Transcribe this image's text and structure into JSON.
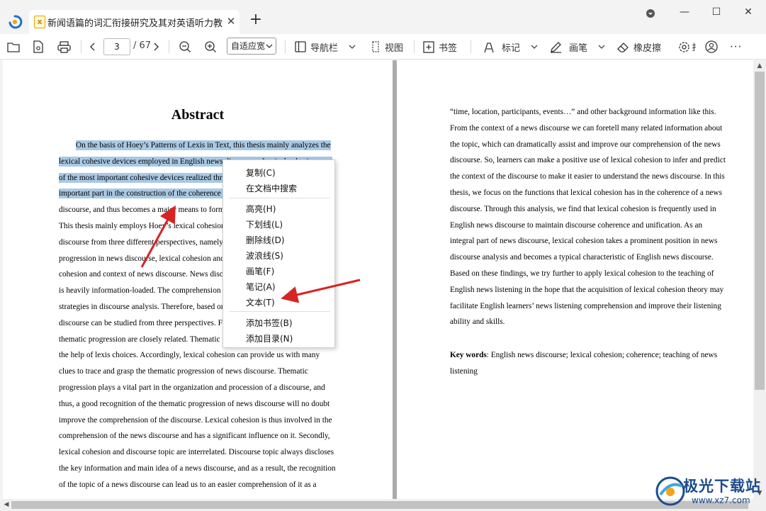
{
  "tab": {
    "title": "新闻语篇的词汇衔接研究及其对英语听力教...",
    "close": "✕"
  },
  "new_tab": "+",
  "window": {
    "menu": "▾",
    "minimize": "—",
    "maximize": "☐",
    "close": "✕"
  },
  "toolbar": {
    "page_current": "3",
    "page_total": "/ 67",
    "zoom": "自适应宽",
    "navbar": "导航栏",
    "view": "视图",
    "bookmark": "书签",
    "mark": "标记",
    "pen": "画笔",
    "eraser": "橡皮擦",
    "more": "···"
  },
  "doc": {
    "left": {
      "title": "Abstract",
      "lines": [
        {
          "t": "On the basis of Hoey’s Patterns of Lexis in Text, this thesis mainly analyzes the",
          "hl": true
        },
        {
          "t": "lexical cohesive devices employed in English news discourses. Lexical cohesion, one",
          "hl": true
        },
        {
          "t": "of the most important cohesive devices realized through vocabulary, is a prominent",
          "hl": true
        },
        {
          "t": "important part in the construction of the coherence and unification of news",
          "hl": true
        },
        {
          "t": "discourse, and thus becomes a major means to formulate a coherent news discourse.",
          "hl": false
        },
        {
          "t": "This thesis mainly employs Hoey’s lexical cohesion theory to analyze the news",
          "hl": false
        },
        {
          "t": "discourse from three different perspectives, namely, lexical cohesion and thematic",
          "hl": false
        },
        {
          "t": "progression in news discourse, lexical cohesion and discourse topic, and lexical",
          "hl": false
        },
        {
          "t": "cohesion and context of news discourse. News discourse is a specific genre which",
          "hl": false
        },
        {
          "t": "is heavily information-loaded. The comprehension of it requires different reading",
          "hl": false
        },
        {
          "t": "strategies in discourse analysis. Therefore, based on Hoey’s theory, the news",
          "hl": false
        },
        {
          "t": "discourse can be studied from three perspectives. Firstly, lexical cohesion and",
          "hl": false
        },
        {
          "t": "thematic progression are closely related. Thematic progression is realized with",
          "hl": false
        },
        {
          "t": "the help of lexis choices. Accordingly, lexical cohesion can provide us with many",
          "hl": false
        },
        {
          "t": "clues to trace and grasp the thematic progression of news discourse. Thematic",
          "hl": false
        },
        {
          "t": "progression plays a vital part in the organization and procession of a discourse, and",
          "hl": false
        },
        {
          "t": "thus, a good recognition of the thematic progression of news discourse will no doubt",
          "hl": false
        },
        {
          "t": "improve the comprehension of the discourse. Lexical cohesion is thus involved in the",
          "hl": false
        },
        {
          "t": "comprehension of the news discourse and has a significant influence on it. Secondly,",
          "hl": false
        },
        {
          "t": "lexical cohesion and discourse topic are interrelated. Discourse topic always discloses",
          "hl": false
        },
        {
          "t": "the key information and main idea of a news discourse, and as a result, the recognition",
          "hl": false
        },
        {
          "t": "of the topic of a news discourse can lead us to an easier comprehension of it as a",
          "hl": false
        }
      ]
    },
    "right": {
      "lines": [
        "“time, location, participants, events…” and other background information like this.",
        "From the context of a news discourse we can foretell many related information about",
        "the topic, which can dramatically assist and improve our comprehension of the news",
        "discourse. So, learners can make a positive use of lexical cohesion to infer and predict",
        "the context of the discourse to make it easier to understand the news discourse. In this",
        "thesis, we focus on the functions that lexical cohesion has in the coherence of a news",
        "discourse. Through this analysis, we find that lexical cohesion is frequently used in",
        "English news discourse to maintain discourse coherence and unification. As an",
        "integral part of news discourse, lexical cohesion takes a prominent position in news",
        "discourse analysis and becomes a typical characteristic of English news discourse.",
        "Based on these findings, we try further to apply lexical cohesion to the teaching of",
        "English news listening in the hope that the acquisition of lexical cohesion theory may",
        "facilitate English learners’ news listening comprehension and improve their listening",
        "ability and skills."
      ],
      "keywords_label": "Key words",
      "keywords_line1": ": English news discourse; lexical cohesion; coherence; teaching of news",
      "keywords_line2": "listening"
    }
  },
  "context_menu": {
    "copy": "复制(C)",
    "search": "在文档中搜索",
    "highlight": "高亮(H)",
    "underline": "下划线(L)",
    "strikethrough": "删除线(D)",
    "wavy": "波浪线(S)",
    "pen": "画笔(F)",
    "note": "笔记(A)",
    "text": "文本(T)",
    "add_bookmark": "添加书签(B)",
    "add_toc": "添加目录(N)"
  },
  "watermark": {
    "line1": "极光下载站",
    "line2": "www.xz7.com"
  },
  "colors": {
    "highlight": "#a9c9e4",
    "arrow": "#d62424",
    "brand": "#1d4c8e"
  }
}
